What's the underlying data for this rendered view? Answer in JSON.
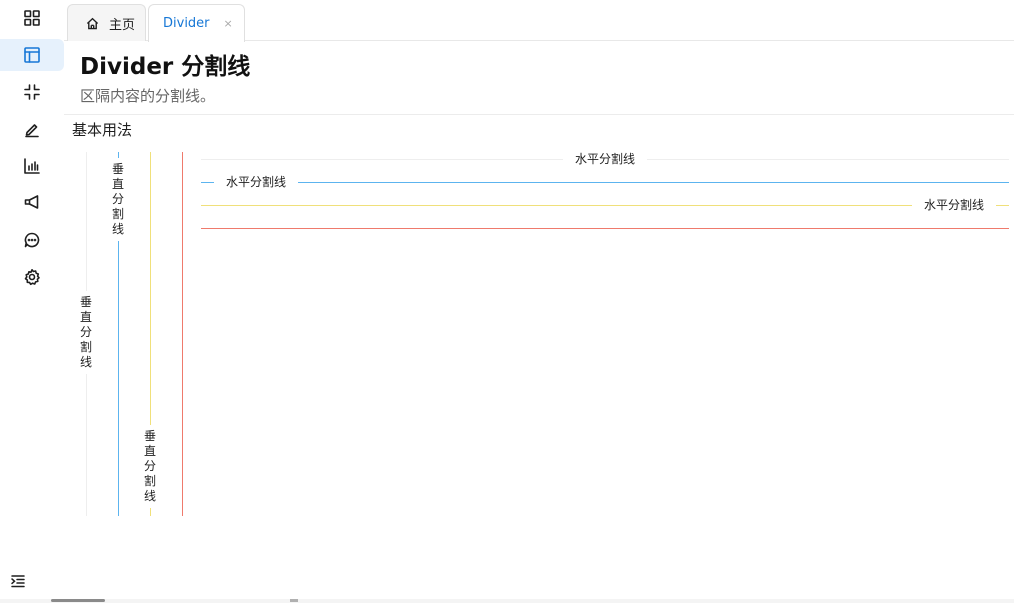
{
  "sidebar": {
    "items": [
      {
        "icon": "apps-grid-icon"
      },
      {
        "icon": "layout-icon",
        "active": true
      },
      {
        "icon": "collapse-icon"
      },
      {
        "icon": "edit-pen-icon"
      },
      {
        "icon": "bar-chart-icon"
      },
      {
        "icon": "megaphone-icon"
      },
      {
        "icon": "chat-bubble-icon"
      },
      {
        "icon": "gear-icon"
      }
    ],
    "bottom_icon": "menu-indent-icon"
  },
  "tabs": [
    {
      "label": "主页",
      "icon": "home-icon",
      "active": false
    },
    {
      "label": "Divider",
      "close": "×",
      "active": true
    }
  ],
  "header": {
    "title": "Divider 分割线",
    "description": "区隔内容的分割线。"
  },
  "section": {
    "title": "基本用法"
  },
  "vertical_dividers": [
    {
      "text": "垂直分割线",
      "align": "center",
      "color": "#eeeeee"
    },
    {
      "text": "垂直分割线",
      "align": "start",
      "color": "#5cb4ef"
    },
    {
      "text": "垂直分割线",
      "align": "end",
      "color": "#f0e07a"
    },
    {
      "text": "",
      "align": "none",
      "color": "#ef7a6c"
    }
  ],
  "horizontal_dividers": [
    {
      "text": "水平分割线",
      "align": "center",
      "color": "#eeeeee"
    },
    {
      "text": "水平分割线",
      "align": "left",
      "color": "#5cb4ef"
    },
    {
      "text": "水平分割线",
      "align": "right",
      "color": "#f0e07a"
    },
    {
      "text": "",
      "align": "none",
      "color": "#ef7a6c"
    }
  ],
  "colors": {
    "accent": "#1677d6",
    "active_bg": "#e6f1fc"
  }
}
